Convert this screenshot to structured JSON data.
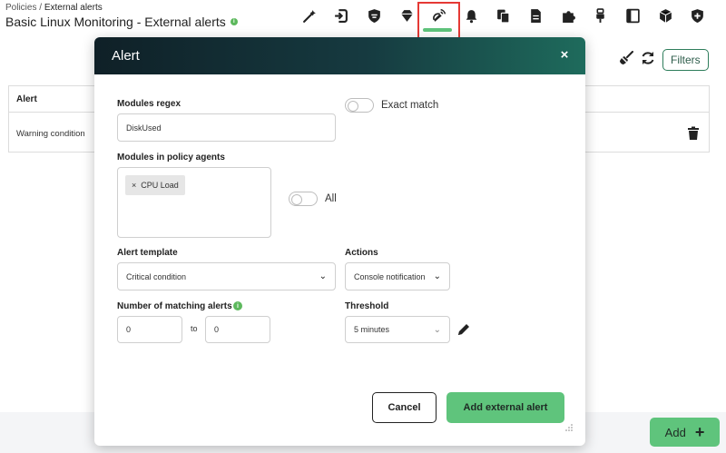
{
  "breadcrumb": {
    "parent": "Policies",
    "separator": " / ",
    "current": "External alerts"
  },
  "page": {
    "title": "Basic Linux Monitoring - External alerts",
    "info_glyph": "i"
  },
  "toolbar": {
    "icons": [
      "wand-icon",
      "sign-in-icon",
      "shield-icon",
      "gem-icon",
      "bell-signal-icon",
      "bell-icon",
      "copy-icon",
      "file-icon",
      "puzzle-icon",
      "plug-icon",
      "book-icon",
      "cube-icon",
      "shield-plus-icon"
    ],
    "active_icon": "bell-signal-icon"
  },
  "background": {
    "filters_label": "Filters",
    "table": {
      "header": "Alert",
      "rows": [
        {
          "alert": "Warning condition"
        }
      ]
    },
    "add_label": "Add",
    "add_glyph": "+"
  },
  "modal": {
    "title": "Alert",
    "close_glyph": "×",
    "modules_regex": {
      "label": "Modules regex",
      "value": "DiskUsed"
    },
    "exact_match": {
      "label": "Exact match",
      "on": false
    },
    "modules_agents": {
      "label": "Modules in policy agents",
      "selected": [
        "CPU Load"
      ],
      "chip_remove_glyph": "×"
    },
    "all_toggle": {
      "label": "All",
      "on": false
    },
    "alert_template": {
      "label": "Alert template",
      "value": "Critical condition"
    },
    "actions": {
      "label": "Actions",
      "value": "Console notification"
    },
    "matching_alerts": {
      "label": "Number of matching alerts",
      "from": "0",
      "to_label": "to",
      "to": "0",
      "info_glyph": "i"
    },
    "threshold": {
      "label": "Threshold",
      "value": "5 minutes"
    },
    "cancel_label": "Cancel",
    "submit_label": "Add external alert"
  },
  "colors": {
    "accent": "#5fc47c",
    "header_dark": "#0f2027",
    "header_teal": "#1e6b5c",
    "highlight": "#e53935"
  }
}
